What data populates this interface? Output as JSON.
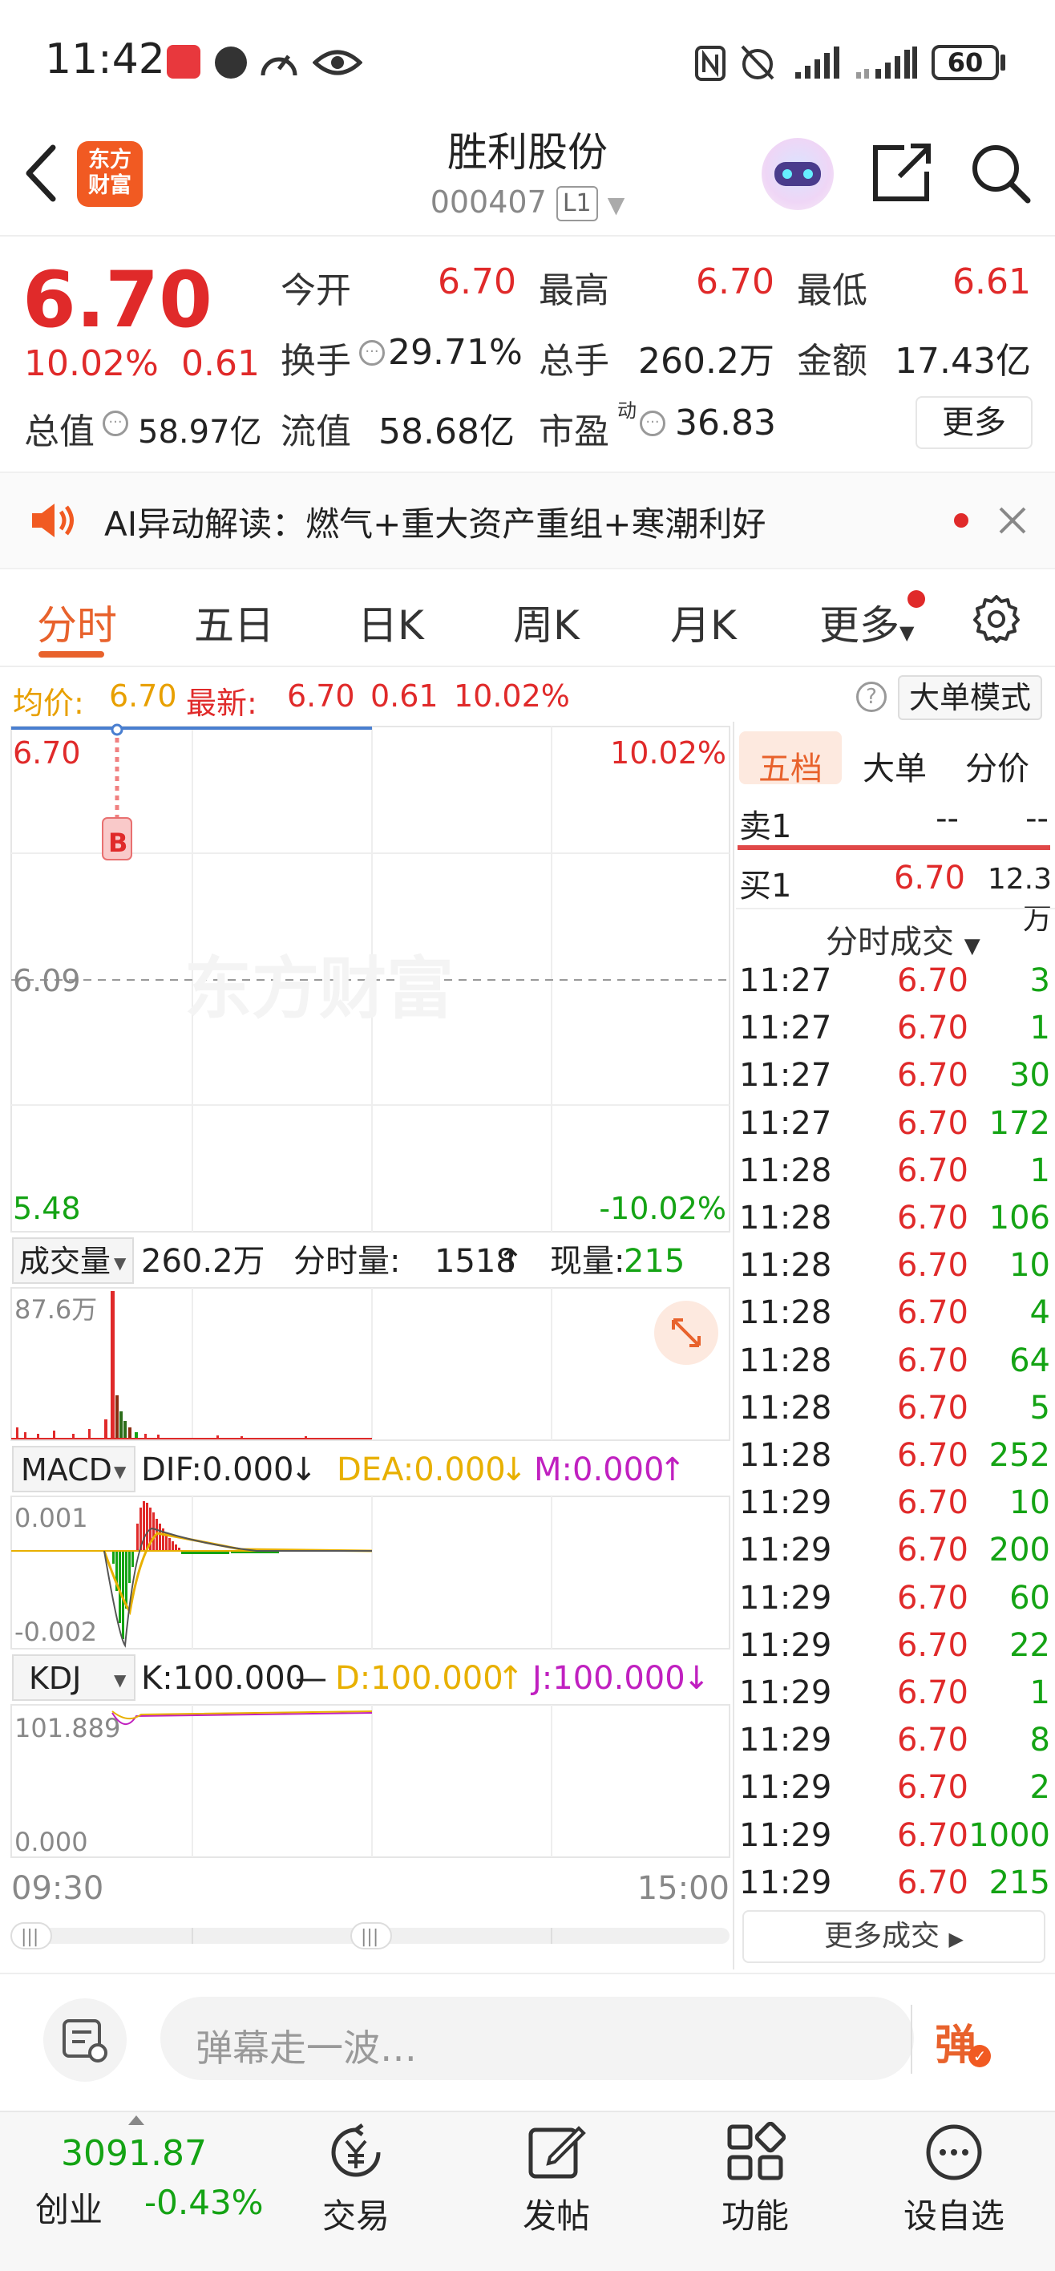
{
  "status_bar": {
    "time": "11:42",
    "battery": "60"
  },
  "header": {
    "app_logo": "东方\n财富",
    "stock_name": "胜利股份",
    "stock_code": "000407",
    "market_badge": "L1"
  },
  "quote": {
    "price": "6.70",
    "change_pct": "10.02%",
    "change_amt": "0.61",
    "rows": [
      [
        {
          "label": "今开",
          "value": "6.70",
          "color": "red"
        },
        {
          "label": "最高",
          "value": "6.70",
          "color": "red"
        },
        {
          "label": "最低",
          "value": "6.61",
          "color": "red"
        }
      ],
      [
        {
          "label": "换手",
          "value": "29.71%",
          "color": "black",
          "info": true
        },
        {
          "label": "总手",
          "value": "260.2万",
          "color": "black"
        },
        {
          "label": "金额",
          "value": "17.43亿",
          "color": "black"
        }
      ]
    ],
    "market_cap_label": "总值",
    "market_cap": "58.97亿",
    "float_cap_label": "流值",
    "float_cap": "58.68亿",
    "pe_label": "市盈",
    "pe_superscript": "动",
    "pe": "36.83",
    "more_label": "更多"
  },
  "ai_banner": {
    "text": "AI异动解读：燃气+重大资产重组+寒潮利好"
  },
  "tabs": [
    "分时",
    "五日",
    "日K",
    "周K",
    "月K",
    "更多"
  ],
  "info_row": {
    "avg_label": "均价:",
    "avg_value": "6.70",
    "latest_label": "最新:",
    "latest_value": "6.70",
    "latest_change": "0.61",
    "latest_pct": "10.02%",
    "big_order_label": "大单模式"
  },
  "chart": {
    "watermark": "东方财富",
    "price_max": "6.70",
    "price_mid": "6.09",
    "price_min": "5.48",
    "pct_max": "10.02%",
    "pct_min": "-10.02%",
    "buy_marker": "B",
    "volume_selector": "成交量",
    "volume_total": "260.2万",
    "tick_volume_label": "分时量:",
    "tick_volume": "1518",
    "current_volume_label": "现量:",
    "current_volume": "215",
    "volume_axis_max": "87.6万",
    "macd_selector": "MACD",
    "macd_dif": "DIF:0.000",
    "macd_dea": "DEA:0.000",
    "macd_m": "M:0.000",
    "macd_axis_max": "0.001",
    "macd_axis_min": "-0.002",
    "kdj_selector": "KDJ",
    "kdj_k": "K:100.000",
    "kdj_d": "D:100.000",
    "kdj_j": "J:100.000",
    "kdj_axis_max": "101.889",
    "kdj_axis_min": "0.000",
    "time_start": "09:30",
    "time_end": "15:00"
  },
  "right_panel": {
    "tabs": [
      "五档",
      "大单",
      "分价"
    ],
    "sell1_label": "卖1",
    "sell1_price": "--",
    "sell1_volume": "--",
    "buy1_label": "买1",
    "buy1_price": "6.70",
    "buy1_volume": "12.3万",
    "deals_header": "分时成交",
    "deals": [
      [
        "11:27",
        "6.70",
        "3"
      ],
      [
        "11:27",
        "6.70",
        "1"
      ],
      [
        "11:27",
        "6.70",
        "30"
      ],
      [
        "11:27",
        "6.70",
        "172"
      ],
      [
        "11:28",
        "6.70",
        "1"
      ],
      [
        "11:28",
        "6.70",
        "106"
      ],
      [
        "11:28",
        "6.70",
        "10"
      ],
      [
        "11:28",
        "6.70",
        "4"
      ],
      [
        "11:28",
        "6.70",
        "64"
      ],
      [
        "11:28",
        "6.70",
        "5"
      ],
      [
        "11:28",
        "6.70",
        "252"
      ],
      [
        "11:29",
        "6.70",
        "10"
      ],
      [
        "11:29",
        "6.70",
        "200"
      ],
      [
        "11:29",
        "6.70",
        "60"
      ],
      [
        "11:29",
        "6.70",
        "22"
      ],
      [
        "11:29",
        "6.70",
        "1"
      ],
      [
        "11:29",
        "6.70",
        "8"
      ],
      [
        "11:29",
        "6.70",
        "2"
      ],
      [
        "11:29",
        "6.70",
        "1000"
      ],
      [
        "11:29",
        "6.70",
        "215"
      ]
    ],
    "more_deals_label": "更多成交"
  },
  "comment_bar": {
    "placeholder": "弹幕走一波…",
    "danmu_label": "弹"
  },
  "bottom_nav": {
    "index_value": "3091.87",
    "index_name": "创业",
    "index_change": "-0.43%",
    "items": [
      "交易",
      "发帖",
      "功能",
      "设自选"
    ]
  }
}
